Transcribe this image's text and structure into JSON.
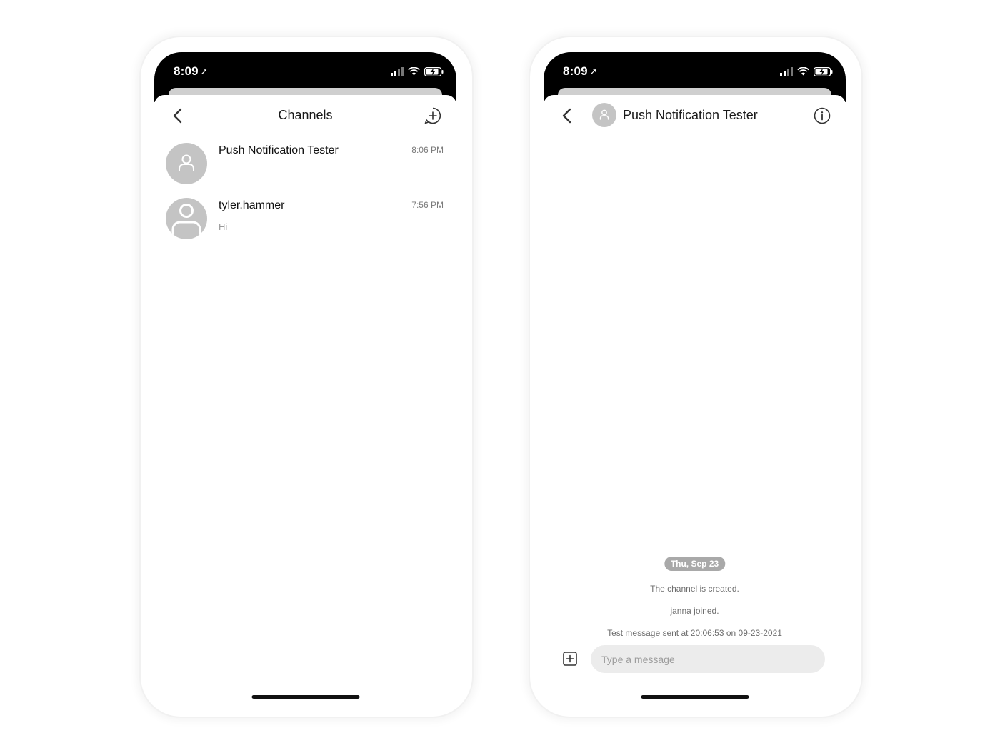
{
  "status_bar": {
    "time": "8:09"
  },
  "channels_screen": {
    "title": "Channels",
    "channels": [
      {
        "name": "Push Notification Tester",
        "time": "8:06 PM",
        "preview": ""
      },
      {
        "name": "tyler.hammer",
        "time": "7:56 PM",
        "preview": "Hi"
      }
    ]
  },
  "chat_screen": {
    "title": "Push Notification Tester",
    "date_separator": "Thu, Sep 23",
    "system_messages": [
      "The channel is created.",
      "janna joined.",
      "Test message sent at 20:06:53 on 09-23-2021"
    ],
    "composer": {
      "placeholder": "Type a message",
      "value": ""
    }
  },
  "icons": {
    "back": "chevron-left-icon",
    "new_channel": "chat-plus-icon",
    "info": "info-icon",
    "attach": "plus-square-icon",
    "location": "location-arrow-icon",
    "signal": "signal-icon",
    "wifi": "wifi-icon",
    "battery": "battery-charging-icon",
    "avatar": "user-avatar-icon"
  },
  "colors": {
    "avatar_bg": "#c4c4c4",
    "date_pill_bg": "#a9a9a9",
    "composer_bg": "#ececec",
    "status_bar_bg": "#000000"
  }
}
